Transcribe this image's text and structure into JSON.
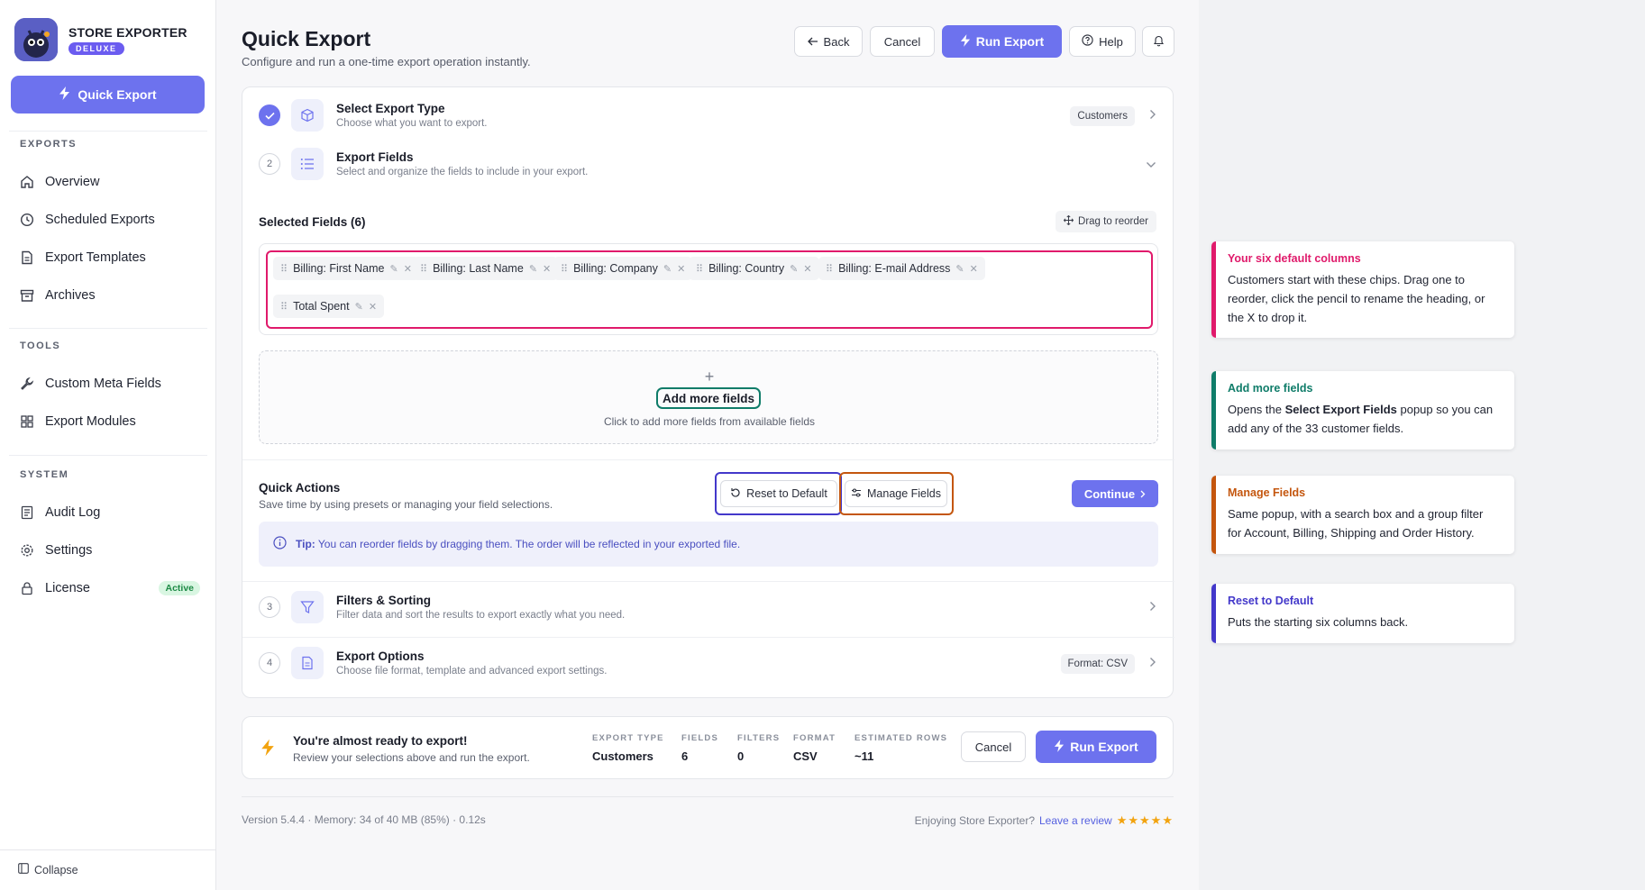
{
  "brand": {
    "name": "STORE EXPORTER",
    "badge": "DELUXE"
  },
  "sidebar": {
    "quick_export": "Quick Export",
    "sections": [
      {
        "title": "EXPORTS",
        "items": [
          "Overview",
          "Scheduled Exports",
          "Export Templates",
          "Archives"
        ]
      },
      {
        "title": "TOOLS",
        "items": [
          "Custom Meta Fields",
          "Export Modules"
        ]
      },
      {
        "title": "SYSTEM",
        "items": [
          "Audit Log",
          "Settings",
          "License"
        ]
      }
    ],
    "license_badge": "Active",
    "collapse": "Collapse"
  },
  "header": {
    "title": "Quick Export",
    "subtitle": "Configure and run a one-time export operation instantly.",
    "back": "Back",
    "cancel": "Cancel",
    "run_export": "Run Export",
    "help": "Help"
  },
  "steps": [
    {
      "num": "1",
      "title": "Select Export Type",
      "desc": "Choose what you want to export.",
      "chip": "Customers",
      "done": true
    },
    {
      "num": "2",
      "title": "Export Fields",
      "desc": "Select and organize the fields to include in your export.",
      "chip": ""
    },
    {
      "num": "3",
      "title": "Filters & Sorting",
      "desc": "Filter data and sort the results to export exactly what you need.",
      "chip": ""
    },
    {
      "num": "4",
      "title": "Export Options",
      "desc": "Choose file format, template and advanced export settings.",
      "chip": "Format: CSV"
    }
  ],
  "fields": {
    "selected_title": "Selected Fields (6)",
    "drag_hint": "Drag to reorder",
    "chips": [
      "Billing: First Name",
      "Billing: Last Name",
      "Billing: Company",
      "Billing: Country",
      "Billing: E-mail Address",
      "Total Spent"
    ],
    "add_title": "Add more fields",
    "add_desc": "Click to add more fields from available fields"
  },
  "quick_actions": {
    "title": "Quick Actions",
    "desc": "Save time by using presets or managing your field selections.",
    "reset": "Reset to Default",
    "manage": "Manage Fields",
    "continue": "Continue",
    "tip_label": "Tip:",
    "tip_text": "You can reorder fields by dragging them. The order will be reflected in your exported file."
  },
  "summary": {
    "title": "You're almost ready to export!",
    "desc": "Review your selections above and run the export.",
    "stats": [
      {
        "label": "EXPORT TYPE",
        "value": "Customers"
      },
      {
        "label": "FIELDS",
        "value": "6"
      },
      {
        "label": "FILTERS",
        "value": "0"
      },
      {
        "label": "FORMAT",
        "value": "CSV"
      },
      {
        "label": "ESTIMATED ROWS",
        "value": "~11"
      }
    ],
    "cancel": "Cancel",
    "run_export": "Run Export"
  },
  "footer": {
    "version": "Version 5.4.4 · Memory: 34 of 40 MB (85%) · 0.12s",
    "enjoy": "Enjoying Store Exporter?",
    "review": "Leave a review",
    "stars": "★★★★★"
  },
  "annotations": [
    {
      "title": "Your six default columns",
      "body": "Customers start with these chips. Drag one to reorder, click the pencil to rename the heading, or the X to drop it.",
      "color": "#e01a6b"
    },
    {
      "title": "Add more fields",
      "body_pre": "Opens the ",
      "body_bold": "Select Export Fields",
      "body_post": " popup so you can add any of the 33 customer fields.",
      "color": "#0f7c69"
    },
    {
      "title": "Manage Fields",
      "body": "Same popup, with a search box and a group filter for Account, Billing, Shipping and Order History.",
      "color": "#c4560e"
    },
    {
      "title": "Reset to Default",
      "body": "Puts the starting six columns back.",
      "color": "#4338ca"
    }
  ],
  "colors": {
    "accent": "#6d72ee",
    "pink": "#e01a6b",
    "teal": "#0f7c69",
    "orange": "#c4560e",
    "indigo": "#4338ca"
  }
}
